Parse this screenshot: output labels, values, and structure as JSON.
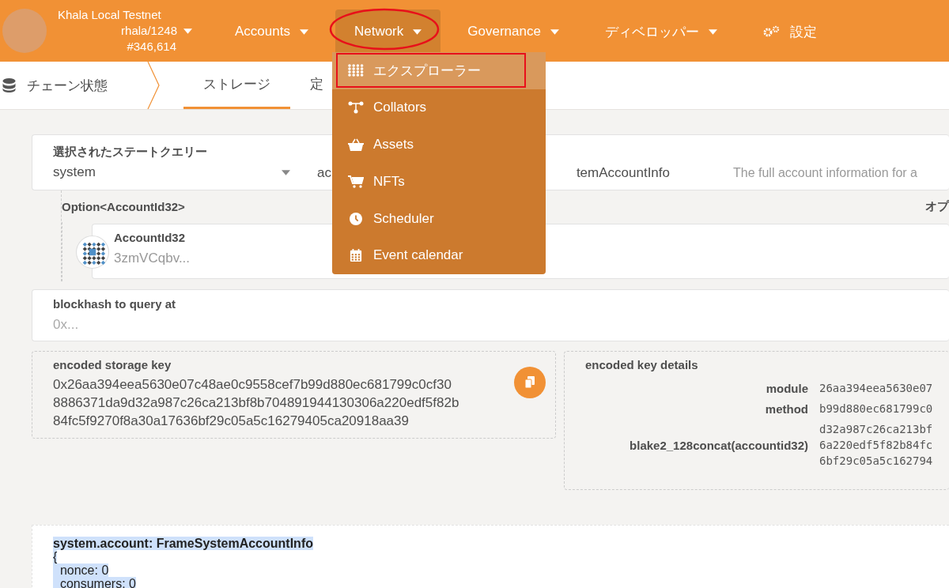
{
  "header": {
    "chain_name": "Khala Local Testnet",
    "runtime": "rhala/1248",
    "block": "#346,614",
    "nav": [
      {
        "kind": "menu",
        "label": "Accounts",
        "selected": false,
        "circled": false
      },
      {
        "kind": "menu",
        "label": "Network",
        "selected": true,
        "circled": true
      },
      {
        "kind": "menu",
        "label": "Governance",
        "selected": false,
        "circled": false
      },
      {
        "kind": "menu",
        "label": "ディベロッパー",
        "selected": false,
        "circled": false
      },
      {
        "kind": "settings",
        "label": "設定",
        "selected": false,
        "circled": false
      }
    ]
  },
  "subnav": {
    "section": "チェーン状態",
    "tabs": [
      {
        "label": "ストレージ",
        "selected": true
      },
      {
        "label": "定",
        "selected": false
      }
    ]
  },
  "network_menu": {
    "items": [
      {
        "label": "エクスプローラー",
        "selected": true,
        "boxed": true
      },
      {
        "label": "Collators",
        "selected": false,
        "boxed": false
      },
      {
        "label": "Assets",
        "selected": false,
        "boxed": false
      },
      {
        "label": "NFTs",
        "selected": false,
        "boxed": false
      },
      {
        "label": "Scheduler",
        "selected": false,
        "boxed": false
      },
      {
        "label": "Event calendar",
        "selected": false,
        "boxed": false
      }
    ]
  },
  "query": {
    "label": "選択されたステートクエリー",
    "module": "system",
    "method_start": "ac",
    "method_end": "temAccountInfo",
    "description": "The full account information for a"
  },
  "parameter": {
    "type_label": "Option<AccountId32>",
    "option_label": "オプ",
    "account_label": "AccountId32",
    "account_value": "3zmVCqbv..."
  },
  "blockhash": {
    "label": "blockhash to query at",
    "placeholder": "0x..."
  },
  "storage_key": {
    "label": "encoded storage key",
    "lines": [
      "0x26aa394eea5630e07c48ae0c9558cef7b99d880ec681799c0cf30",
      "8886371da9d32a987c26ca213bf8b704891944130306a220edf5f82b",
      "84fc5f9270f8a30a17636bf29c05a5c16279405ca20918aa39"
    ]
  },
  "key_details": {
    "label": "encoded key details",
    "rows": [
      {
        "name": "module",
        "lines": [
          "26aa394eea5630e07"
        ]
      },
      {
        "name": "method",
        "lines": [
          "b99d880ec681799c0"
        ]
      },
      {
        "name": "blake2_128concat(accountid32)",
        "lines": [
          "d32a987c26ca213bf",
          "6a220edf5f82b84fc",
          "6bf29c05a5c162794"
        ]
      }
    ]
  },
  "result": {
    "lines": [
      {
        "kind": "title",
        "text": "system.account: FrameSystemAccountInfo",
        "selected": true
      },
      {
        "kind": "code",
        "text": "{",
        "selected": true
      },
      {
        "kind": "code",
        "text": "  nonce: 0",
        "selected": true
      },
      {
        "kind": "code",
        "text": "  consumers: 0",
        "selected": true
      }
    ]
  }
}
